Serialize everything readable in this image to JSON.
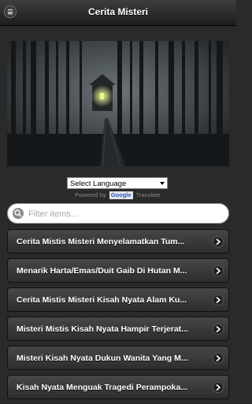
{
  "header": {
    "title": "Cerita Misteri",
    "menu_icon": "menu-icon"
  },
  "translate": {
    "select_label": "Select Language",
    "powered_prefix": "Powered by",
    "google_label": "Google",
    "translate_label": "Translate"
  },
  "search": {
    "placeholder": "Filter items..."
  },
  "list": {
    "items": [
      {
        "label": "Cerita Mistis Misteri Menyelamatkan Tum..."
      },
      {
        "label": "Menarik Harta/Emas/Duit Gaib Di Hutan M..."
      },
      {
        "label": "Cerita Mistis Misteri Kisah Nyata Alam Ku..."
      },
      {
        "label": "Misteri Mistis Kisah Nyata Hampir Terjerat..."
      },
      {
        "label": "Misteri Kisah Nyata Dukun Wanita Yang M..."
      },
      {
        "label": "Kisah Nyata Menguak Tragedi Perampoka..."
      }
    ]
  },
  "colors": {
    "accent_light": "#e8f080"
  }
}
